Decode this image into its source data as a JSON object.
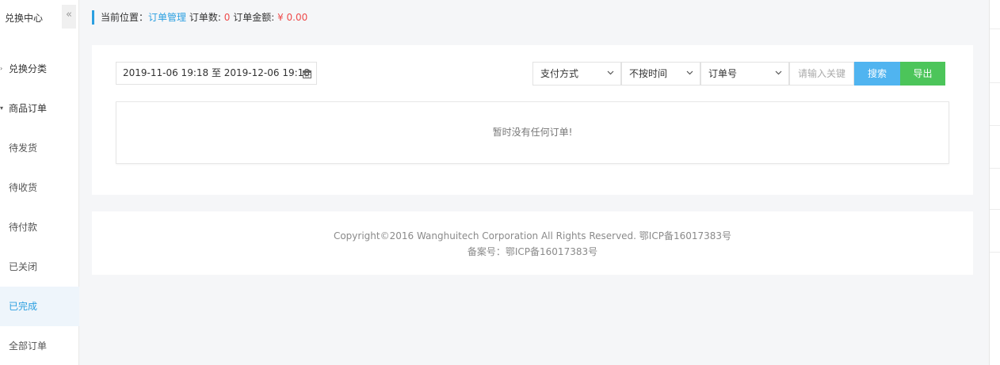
{
  "sidebar": {
    "title": "兑换中心",
    "collapse_glyph": "«",
    "items": [
      {
        "label": "兑换分类",
        "type": "category",
        "caret": "›"
      },
      {
        "label": "商品订单",
        "type": "category",
        "caret": "▾"
      },
      {
        "label": "待发货",
        "type": "item"
      },
      {
        "label": "待收货",
        "type": "item"
      },
      {
        "label": "待付款",
        "type": "item"
      },
      {
        "label": "已关闭",
        "type": "item"
      },
      {
        "label": "已完成",
        "type": "item",
        "active": true
      },
      {
        "label": "全部订单",
        "type": "item"
      }
    ]
  },
  "breadcrumb": {
    "prefix": "当前位置：",
    "link": "订单管理",
    "count_label": "订单数:",
    "count_value": "0",
    "amount_label": "订单金额:",
    "amount_value": "¥ 0.00"
  },
  "filters": {
    "date_range": "2019-11-06 19:18 至 2019-12-06 19:18",
    "payment_select": "支付方式",
    "time_select": "不按时间",
    "field_select": "订单号",
    "keyword_placeholder": "请输入关键",
    "search_label": "搜索",
    "export_label": "导出"
  },
  "results": {
    "empty_message": "暂时没有任何订单!"
  },
  "footer": {
    "copyright": "Copyright©2016 Wanghuitech Corporation All Rights Reserved. 鄂ICP备16017383号",
    "icp": "备案号：鄂ICP备16017383号"
  },
  "colors": {
    "accent": "#2b9fe0",
    "search_button": "#50b4f0",
    "export_button": "#4cc55a",
    "warning_text": "#ee4b4b"
  },
  "icons": {
    "calendar": "calendar-icon",
    "chevron": "chevron-down-icon"
  }
}
